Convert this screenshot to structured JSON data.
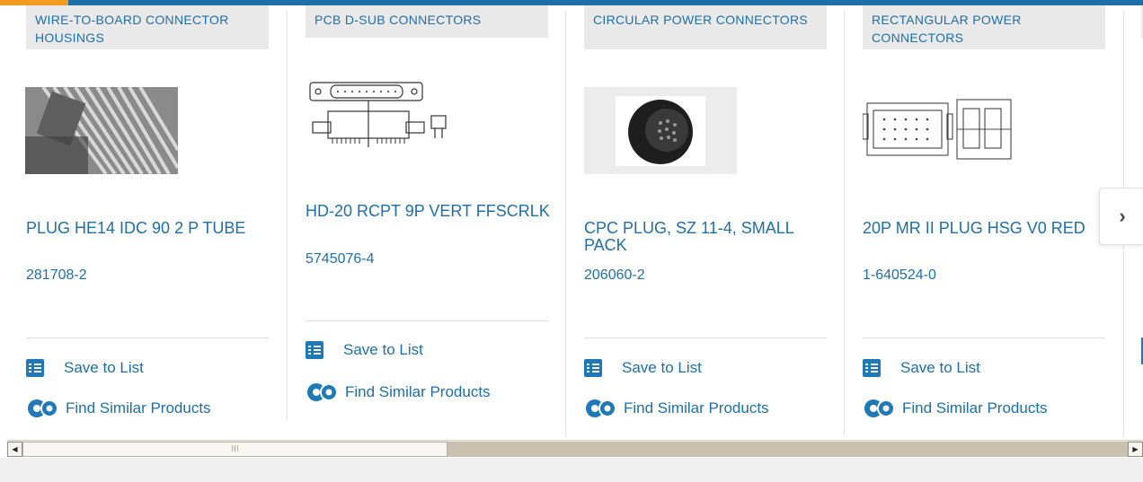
{
  "products": [
    {
      "category": "WIRE-TO-BOARD CONNECTOR HOUSINGS",
      "title": "PLUG HE14 IDC 90 2 P TUBE",
      "part_number": "281708-2",
      "save_label": "Save to List",
      "similar_label": "Find Similar Products",
      "image_icon": "ribbon-cable-connector-photo"
    },
    {
      "category": "PCB D-SUB CONNECTORS",
      "title": "HD-20 RCPT 9P VERT FFSCRLK",
      "part_number": "5745076-4",
      "save_label": "Save to List",
      "similar_label": "Find Similar Products",
      "image_icon": "d-sub-connector-drawing"
    },
    {
      "category": "CIRCULAR POWER CONNECTORS",
      "title": "CPC PLUG, SZ 11-4, SMALL PACK",
      "part_number": "206060-2",
      "save_label": "Save to List",
      "similar_label": "Find Similar Products",
      "image_icon": "circular-plug-photo"
    },
    {
      "category": "RECTANGULAR POWER CONNECTORS",
      "title": "20P MR II PLUG HSG V0 RED",
      "part_number": "1-640524-0",
      "save_label": "Save to List",
      "similar_label": "Find Similar Products",
      "image_icon": "rectangular-housing-drawing"
    }
  ],
  "carousel": {
    "next_label": "›"
  },
  "scrollbar": {
    "left_arrow": "◀",
    "right_arrow": "▶",
    "grip": "III"
  },
  "colors": {
    "link": "#1d6fab",
    "brand_bar": "#1e6fa8",
    "accent": "#f29a1f",
    "category_bg": "#e9e9e9"
  }
}
